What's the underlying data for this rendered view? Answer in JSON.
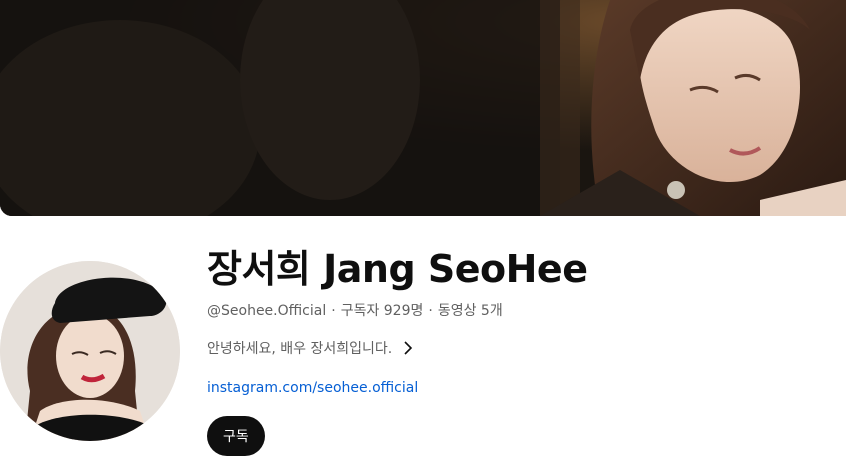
{
  "channel": {
    "name": "장서희 Jang SeoHee",
    "handle": "@Seohee.Official",
    "separator": "·",
    "subscribers": "구독자 929명",
    "videos": "동영상 5개",
    "description": "안녕하세요, 배우 장서희입니다.",
    "link": "instagram.com/seohee.official"
  },
  "actions": {
    "subscribe_label": "구독"
  },
  "icons": {
    "description_more": "chevron-right-icon"
  },
  "colors": {
    "link": "#065fd4",
    "subscribe_bg": "#0f0f0f",
    "secondary_text": "#606060"
  }
}
